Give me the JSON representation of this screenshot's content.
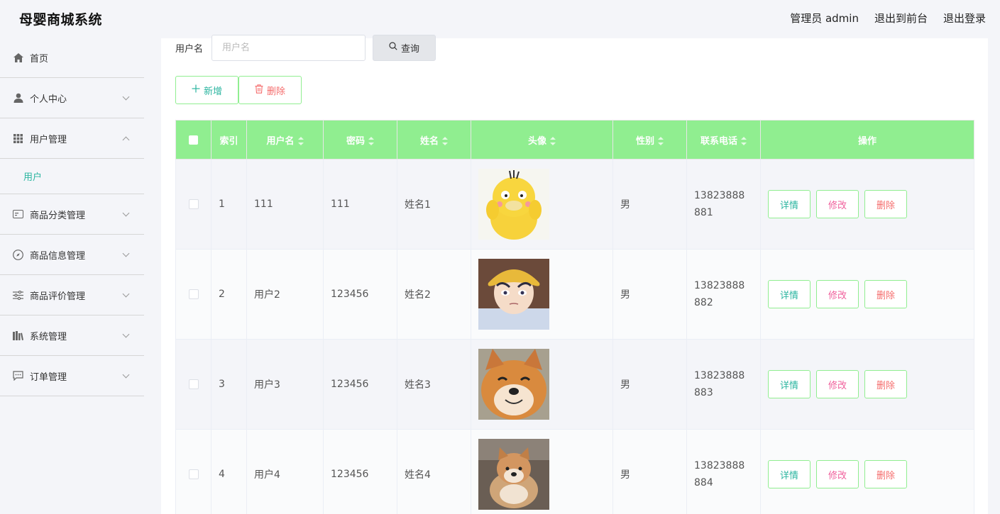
{
  "app": {
    "title": "母婴商城系统"
  },
  "header": {
    "admin_label": "管理员 admin",
    "exit_front": "退出到前台",
    "logout": "退出登录"
  },
  "sidebar": {
    "items": [
      {
        "label": "首页"
      },
      {
        "label": "个人中心"
      },
      {
        "label": "用户管理"
      },
      {
        "label": "用户"
      },
      {
        "label": "商品分类管理"
      },
      {
        "label": "商品信息管理"
      },
      {
        "label": "商品评价管理"
      },
      {
        "label": "系统管理"
      },
      {
        "label": "订单管理"
      }
    ]
  },
  "search": {
    "label": "用户名",
    "placeholder": "用户名",
    "button": "查询"
  },
  "actions": {
    "add": "新增",
    "delete": "删除"
  },
  "table": {
    "headers": {
      "index": "索引",
      "username": "用户名",
      "password": "密码",
      "name": "姓名",
      "avatar": "头像",
      "gender": "性别",
      "phone": "联系电话",
      "ops": "操作"
    },
    "rows": [
      {
        "index": "1",
        "username": "111",
        "password": "111",
        "name": "姓名1",
        "gender": "男",
        "phone": "13823888881"
      },
      {
        "index": "2",
        "username": "用户2",
        "password": "123456",
        "name": "姓名2",
        "gender": "男",
        "phone": "13823888882"
      },
      {
        "index": "3",
        "username": "用户3",
        "password": "123456",
        "name": "姓名3",
        "gender": "男",
        "phone": "13823888883"
      },
      {
        "index": "4",
        "username": "用户4",
        "password": "123456",
        "name": "姓名4",
        "gender": "男",
        "phone": "13823888884"
      }
    ],
    "ops": {
      "detail": "详情",
      "edit": "修改",
      "remove": "删除"
    }
  },
  "colors": {
    "header_green": "#90ee90",
    "accent_teal": "#2bb5a0",
    "danger": "#f56c6c",
    "edit_pink": "#f0609c"
  }
}
